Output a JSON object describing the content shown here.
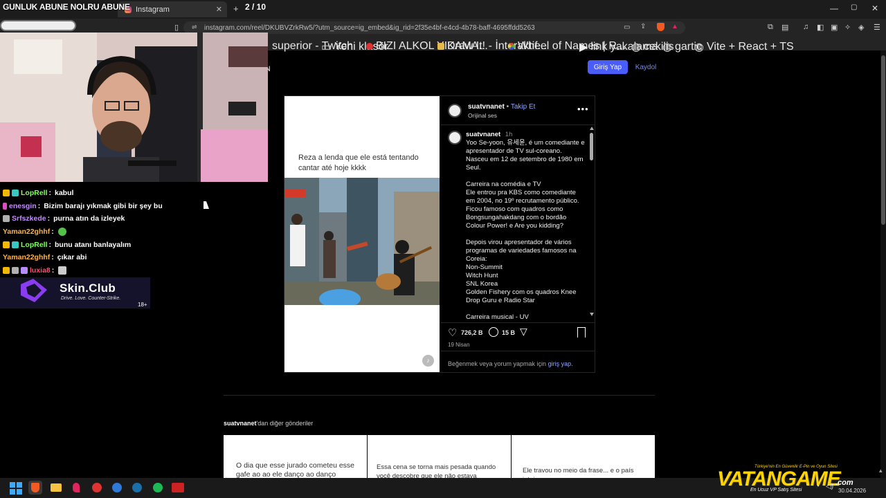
{
  "overlay": {
    "title": "GUNLUK ABUNE NOLRU ABUNE",
    "tab_count": "2 / 10",
    "chat": [
      {
        "user": "LopRell",
        "user_color": "#7fff5a",
        "message": "kabul"
      },
      {
        "user": "enesgin",
        "user_color": "#c38bff",
        "message": "Bizim barajı yıkmak gibi bir şey bu"
      },
      {
        "user": "Srfszkede",
        "user_color": "#c38bff",
        "message": "purna atın da izleyek"
      },
      {
        "user": "Yaman22ghhf",
        "user_color": "#ffb347",
        "message": ""
      },
      {
        "user": "LopRell",
        "user_color": "#7fff5a",
        "message": "bunu atanı banlayalım"
      },
      {
        "user": "Yaman22ghhf",
        "user_color": "#ffb347",
        "message": "çıkar abi"
      },
      {
        "user": "luxia8",
        "user_color": "#ff4d6d",
        "message": ""
      }
    ],
    "ad": {
      "brand": "Skin.Club",
      "tagline": "Drive. Love. Counter-Strike.",
      "age": "18+"
    }
  },
  "browser": {
    "tab_label": "Instagram",
    "url": "instagram.com/reel/DKUBVZrkRw5/?utm_source=ig_embed&ig_rid=2f35e4bf-e4cd-4b78-baff-4695ffdd5263",
    "bookmarks": [
      "superior - Twitch",
      "Yeni klasör",
      "BIZI ALKOL YIKAMA...",
      "Draw It! - İnteraktif...",
      "Wheel of Names | R...",
      "link yakalama",
      "cekilis",
      "gartic",
      "Vite + React + TS"
    ]
  },
  "header": {
    "login": "Giriş Yap",
    "signup": "Kaydol"
  },
  "post": {
    "username": "suatvnanet",
    "follow": "Takip Et",
    "audio": "Orijinal ses",
    "media_caption": "Reza a lenda que ele está tentando cantar até hoje kkkk",
    "comment_user": "suatvnanet",
    "comment_time": "1h",
    "comment_text": "Yoo Se-yoon, 유세윤, é um comediante e apresentador de TV sul-coreano. Nasceu em 12 de setembro de 1980 em Seul.\n\nCarreira na comédia e TV\nEle entrou pra KBS como comediante em 2004, no 19º recrutamento público. Ficou famoso com quadros como Bongsungahakdang com o bordão Colour Power! e Are you kidding?\n\nDepois virou apresentador de vários programas de variedades famosos na Coreia:\nNon-Summit\nWitch Hunt\nSNL Korea\nGolden Fishery com os quadros Knee Drop Guru e Radio Star\n\nCarreira musical - UV",
    "likes": "726,2 B",
    "comments": "15 B",
    "date": "19 Nisan",
    "login_prompt": "Beğenmek veya yorum yapmak için",
    "login_link": "giriş yap",
    "login_suffix": "."
  },
  "more": {
    "header_user": "suatvnanet",
    "header_suffix": "'dan diğer gönderiler",
    "cards": [
      "O dia que esse jurado cometeu esse gafe ao ao ele danço ao danço",
      "Essa cena se torna mais pesada quando você descobre que ele não estava atuando",
      "Ele travou no meio da frase... e o país inteiro"
    ]
  },
  "watermark": {
    "brand": "VATANGAME",
    "tagline": "Türkiye'nin En Güvenilir E-Pin ve Oyun Sitesi",
    "sub": "En Ucuz VP Satış Sitesi",
    "domain": ".com"
  },
  "taskbar": {
    "date": "30.04.2026"
  },
  "colors": {
    "accent": "#4a5df9",
    "link": "#8fa8ff",
    "bg": "#000000"
  }
}
